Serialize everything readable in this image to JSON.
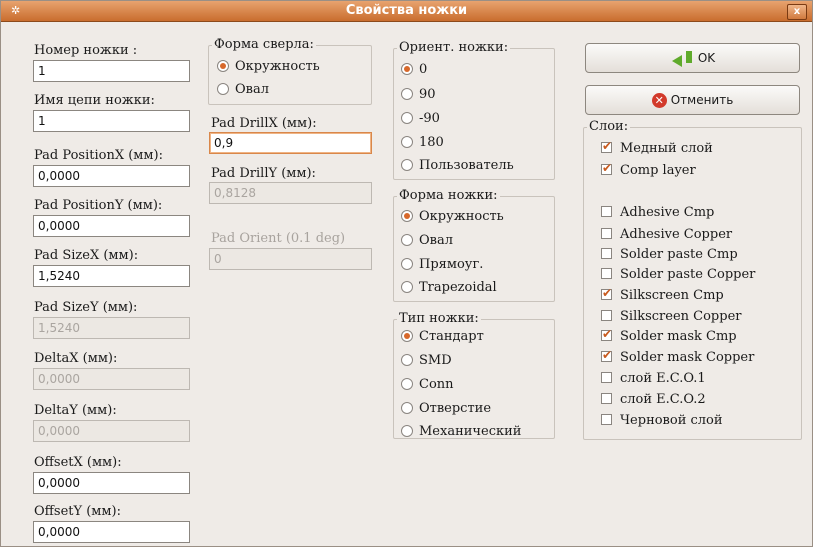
{
  "window": {
    "title": "Свойства ножки",
    "menu_icon": "window-menu-icon",
    "close_label": "x"
  },
  "left": {
    "fields": [
      {
        "label": "Номер ножки :",
        "value": "1",
        "enabled": true
      },
      {
        "label": "Имя цепи ножки:",
        "value": "1",
        "enabled": true
      },
      {
        "label": "Pad PositionX (мм):",
        "value": "0,0000",
        "enabled": true
      },
      {
        "label": "Pad PositionY (мм):",
        "value": "0,0000",
        "enabled": true
      },
      {
        "label": "Pad SizeX (мм):",
        "value": "1,5240",
        "enabled": true
      },
      {
        "label": "Pad SizeY (мм):",
        "value": "1,5240",
        "enabled": false
      },
      {
        "label": "DeltaX (мм):",
        "value": "0,0000",
        "enabled": false
      },
      {
        "label": "DeltaY (мм):",
        "value": "0,0000",
        "enabled": false
      },
      {
        "label": "OffsetX (мм):",
        "value": "0,0000",
        "enabled": true
      },
      {
        "label": "OffsetY (мм):",
        "value": "0,0000",
        "enabled": true
      }
    ]
  },
  "drill_shape": {
    "title": "Форма сверла:",
    "options": [
      "Окружность",
      "Овал"
    ],
    "selected": 0
  },
  "drill": {
    "drillx_label": "Pad DrillX (мм):",
    "drillx_value": "0,9",
    "drilly_label": "Pad DrillY (мм):",
    "drilly_value": "0,8128",
    "orient_label": "Pad Orient (0.1 deg)",
    "orient_value": "0"
  },
  "orientation": {
    "title": "Ориент. ножки:",
    "options": [
      "0",
      "90",
      "-90",
      "180",
      "Пользователь"
    ],
    "selected": 0
  },
  "pad_shape": {
    "title": "Форма ножки:",
    "options": [
      "Окружность",
      "Овал",
      "Прямоуг.",
      "Trapezoidal"
    ],
    "selected": 0
  },
  "pad_type": {
    "title": "Тип ножки:",
    "options": [
      "Стандарт",
      "SMD",
      "Conn",
      "Отверстие",
      "Механический"
    ],
    "selected": 0
  },
  "buttons": {
    "ok": "OK",
    "cancel": "Отменить"
  },
  "layers": {
    "title": "Слои:",
    "items": [
      {
        "label": "Медный слой",
        "checked": true
      },
      {
        "label": "Comp layer",
        "checked": true
      },
      {
        "label": "Adhesive Cmp",
        "checked": false
      },
      {
        "label": "Adhesive Copper",
        "checked": false
      },
      {
        "label": "Solder paste Cmp",
        "checked": false
      },
      {
        "label": "Solder paste Copper",
        "checked": false
      },
      {
        "label": "Silkscreen Cmp",
        "checked": true
      },
      {
        "label": "Silkscreen Copper",
        "checked": false
      },
      {
        "label": "Solder mask Cmp",
        "checked": true
      },
      {
        "label": "Solder mask Copper",
        "checked": true
      },
      {
        "label": "слой E.C.O.1",
        "checked": false
      },
      {
        "label": "слой E.C.O.2",
        "checked": false
      },
      {
        "label": "Черновой слой",
        "checked": false
      }
    ]
  }
}
